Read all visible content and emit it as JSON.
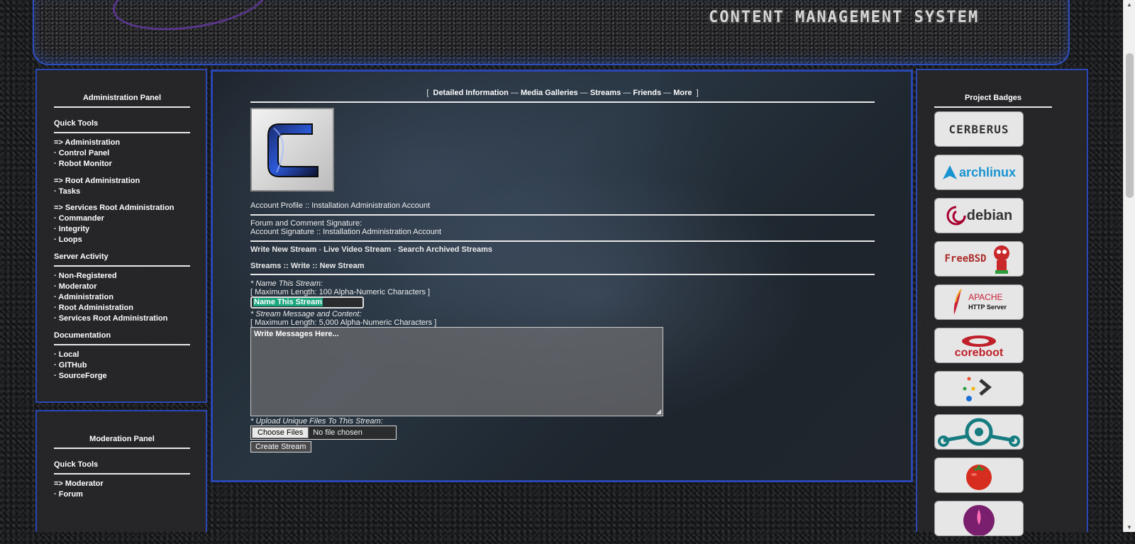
{
  "header": {
    "title": "CONTENT MANAGEMENT SYSTEM"
  },
  "admin_panel": {
    "title": "Administration Panel",
    "sections": [
      {
        "title": "Quick Tools",
        "groups": [
          [
            "=> Administration",
            "· Control Panel",
            "· Robot Monitor"
          ],
          [
            "=> Root Administration",
            "· Tasks"
          ],
          [
            "=> Services Root Administration",
            "· Commander",
            "· Integrity",
            "· Loops"
          ]
        ]
      },
      {
        "title": "Server Activity",
        "groups": [
          [
            "· Non-Registered",
            "· Moderator",
            "· Administration",
            "· Root Administration",
            "· Services Root Administration"
          ]
        ]
      },
      {
        "title": "Documentation",
        "groups": [
          [
            "· Local",
            "· GITHub",
            "· SourceForge"
          ]
        ]
      }
    ]
  },
  "moderation_panel": {
    "title": "Moderation Panel",
    "quick_tools_title": "Quick Tools",
    "items": [
      "=> Moderator",
      "· Forum"
    ]
  },
  "nav": {
    "bracket_open": "[",
    "bracket_close": "]",
    "separator": "—",
    "links": [
      "Detailed Information",
      "Media Galleries",
      "Streams",
      "Friends",
      "More"
    ]
  },
  "profile": {
    "avatar_letter": "C",
    "account_profile": "Account Profile :: Installation Administration Account",
    "signature_label": "Forum and Comment Signature:",
    "signature_value": "Account Signature :: Installation Administration Account"
  },
  "stream_nav": {
    "links": [
      "Write New Stream",
      "Live Video Stream",
      "Search Archived Streams"
    ],
    "separator": "-"
  },
  "breadcrumb": "Streams :: Write :: New Stream",
  "form": {
    "name_label": "* Name This Stream:",
    "name_limit": "[ Maximum Length: 100 Alpha-Numeric Characters ]",
    "name_value": "Name This Stream",
    "message_label": "* Stream Message and Content:",
    "message_limit": "[ Maximum Length: 5,000 Alpha-Numeric Characters ]",
    "message_placeholder": "Write Messages Here...",
    "upload_label": "* Upload Unique Files To This Stream:",
    "choose_files": "Choose Files",
    "no_file": "No file chosen",
    "submit": "Create Stream"
  },
  "badges_panel": {
    "title": "Project Badges",
    "badges": [
      {
        "icon": "cerberus-logo-icon",
        "text": "CERBERUS",
        "color": "#3b3b3b"
      },
      {
        "icon": "archlinux-logo-icon",
        "text": "archlinux",
        "color": "#1793d1"
      },
      {
        "icon": "debian-logo-icon",
        "text": "debian",
        "color": "#a80030"
      },
      {
        "icon": "freebsd-logo-icon",
        "text": "FreeBSD",
        "color": "#ab2b28"
      },
      {
        "icon": "apache-logo-icon",
        "text": "APACHE",
        "subtext": "HTTP Server",
        "color": "#c92037"
      },
      {
        "icon": "coreboot-logo-icon",
        "text": "coreboot",
        "color": "#c0202a"
      },
      {
        "icon": "devlogo-icon",
        "text": "",
        "color": "#333333"
      },
      {
        "icon": "lineageos-logo-icon",
        "text": "",
        "color": "#167c80"
      },
      {
        "icon": "tomato-logo-icon",
        "text": "",
        "color": "#d62d20"
      },
      {
        "icon": "lotus-logo-icon",
        "text": "",
        "color": "#7a1f6e"
      }
    ]
  }
}
